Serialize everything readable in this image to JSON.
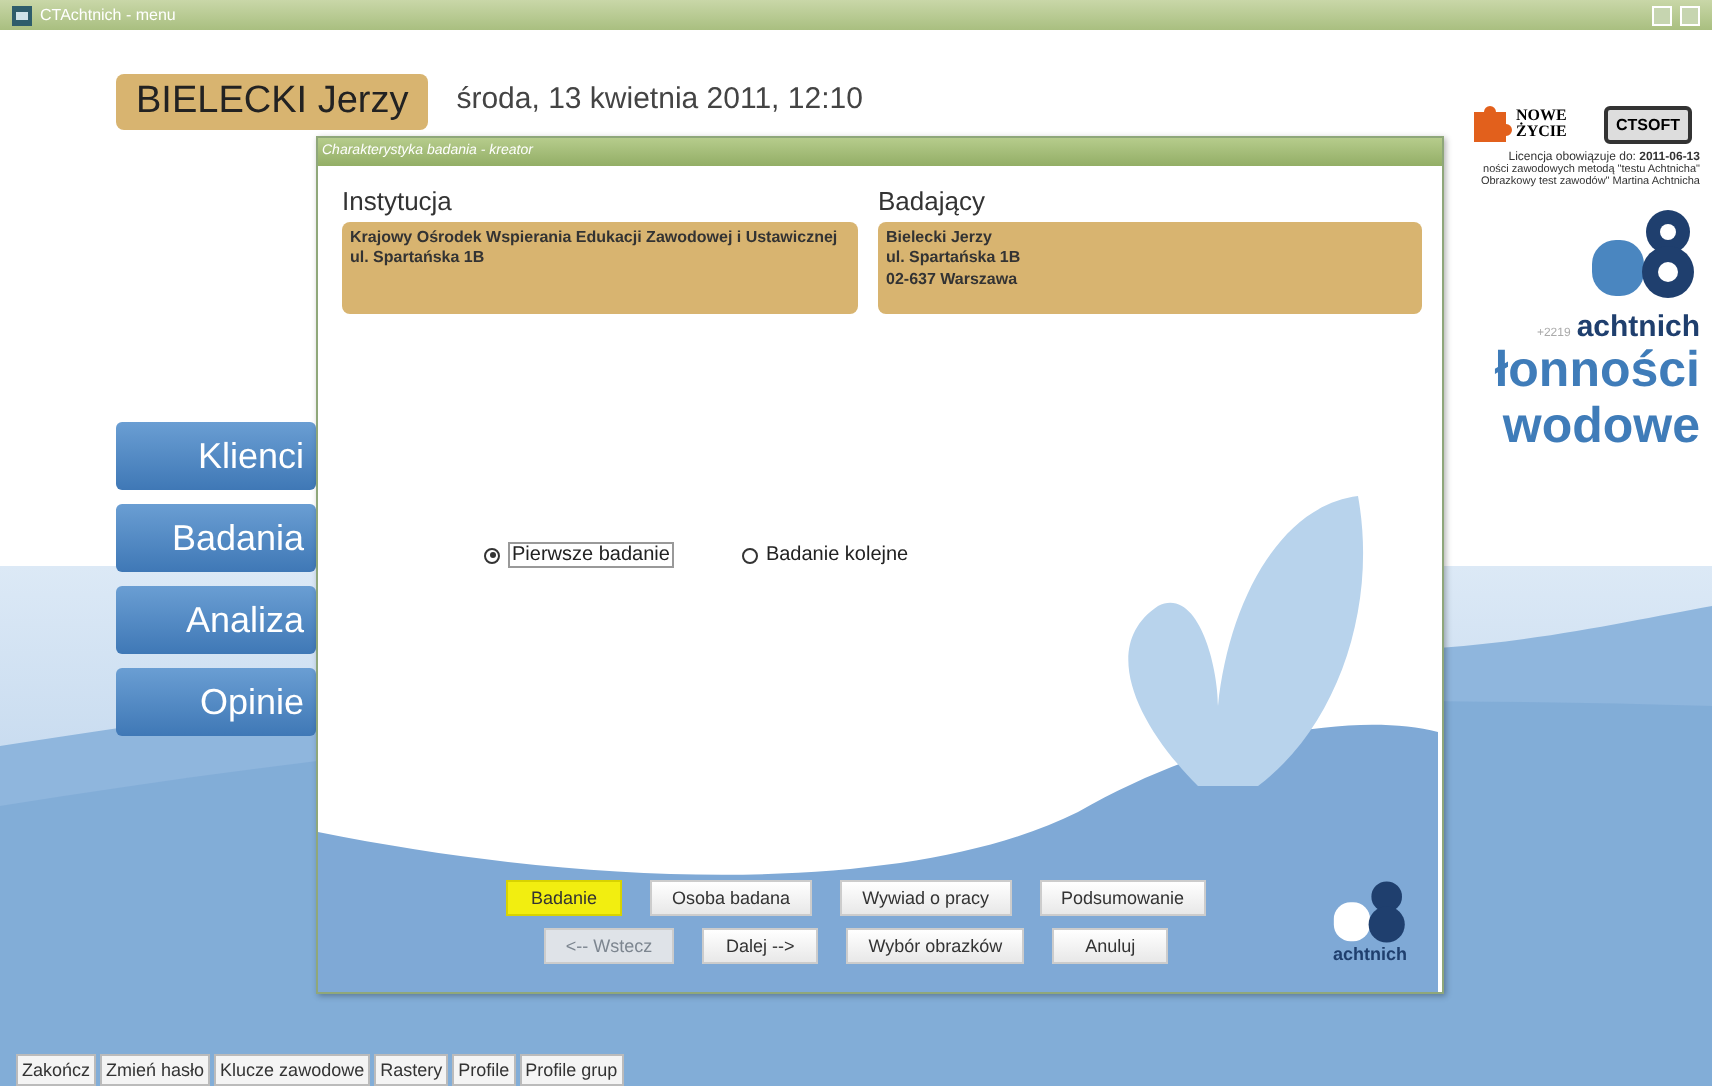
{
  "window": {
    "title": "CTAchtnich - menu"
  },
  "header": {
    "user_name": "BIELECKI Jerzy",
    "date": "środa, 13 kwietnia 2011, 12:10"
  },
  "logos": {
    "partner": "NOWE ŻYCIE",
    "vendor": "CTSOFT",
    "product": "achtnich",
    "version": "+2219"
  },
  "license": {
    "label": "Licencja obowiązuje do:",
    "date": "2011-06-13",
    "lines": [
      "ności zawodowych metodą \"testu Achtnicha\"",
      "Obrazkowy test zawodów\" Martina Achtnicha"
    ]
  },
  "app_title": [
    "łonności",
    "wodowe"
  ],
  "main_menu": [
    {
      "label": "Klienci"
    },
    {
      "label": "Badania"
    },
    {
      "label": "Analiza"
    },
    {
      "label": "Opinie"
    }
  ],
  "dialog": {
    "title": "Charakterystyka badania - kreator",
    "institution": {
      "heading": "Instytucja",
      "lines": [
        "Krajowy Ośrodek Wspierania Edukacji Zawodowej i Ustawicznej",
        "ul. Spartańska 1B"
      ]
    },
    "examiner": {
      "heading": "Badający",
      "lines": [
        "Bielecki Jerzy",
        "ul. Spartańska 1B",
        "02-637 Warszawa"
      ]
    },
    "options": [
      {
        "label": "Pierwsze badanie",
        "selected": true
      },
      {
        "label": "Badanie kolejne",
        "selected": false
      }
    ],
    "steps": [
      {
        "label": "Badanie",
        "selected": true
      },
      {
        "label": "Osoba badana",
        "selected": false
      },
      {
        "label": "Wywiad o pracy",
        "selected": false
      },
      {
        "label": "Podsumowanie",
        "selected": false
      }
    ],
    "actions": [
      {
        "label": "<-- Wstecz",
        "disabled": true
      },
      {
        "label": "Dalej -->",
        "disabled": false
      },
      {
        "label": "Wybór obrazków",
        "disabled": false
      },
      {
        "label": "Anuluj",
        "disabled": false
      }
    ],
    "logo": "achtnich"
  },
  "bottom_toolbar": [
    "Zakończ",
    "Zmień hasło",
    "Klucze zawodowe",
    "Rastery",
    "Profile",
    "Profile grup"
  ]
}
